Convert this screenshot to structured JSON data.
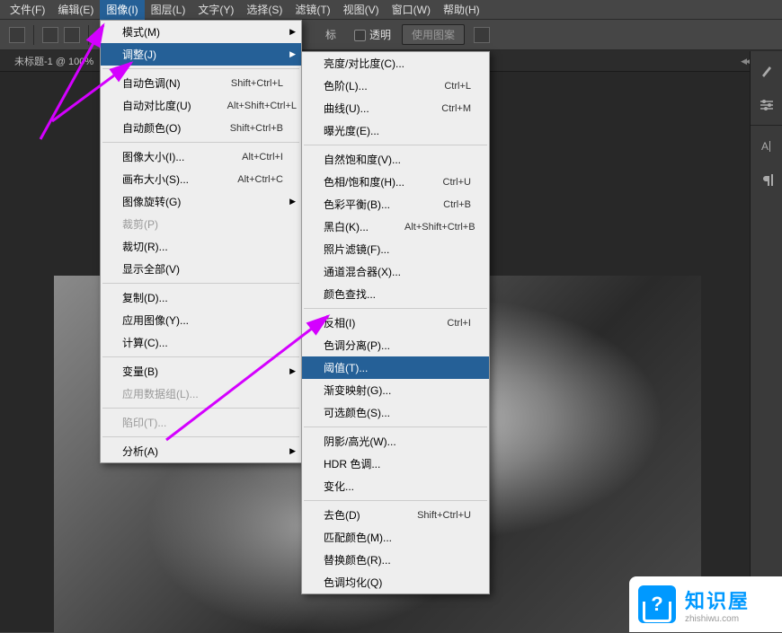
{
  "menubar": {
    "items": [
      {
        "label": "文件(F)"
      },
      {
        "label": "编辑(E)"
      },
      {
        "label": "图像(I)",
        "active": true
      },
      {
        "label": "图层(L)"
      },
      {
        "label": "文字(Y)"
      },
      {
        "label": "选择(S)"
      },
      {
        "label": "滤镜(T)"
      },
      {
        "label": "视图(V)"
      },
      {
        "label": "窗口(W)"
      },
      {
        "label": "帮助(H)"
      }
    ]
  },
  "toolbar": {
    "target_label": "标",
    "transparent_label": "透明",
    "pattern_btn": "使用图案"
  },
  "doc_tab": "未标题-1 @ 100%",
  "image_menu": {
    "groups": [
      [
        {
          "label": "模式(M)",
          "submenu": true
        },
        {
          "label": "调整(J)",
          "submenu": true,
          "highlighted": true
        }
      ],
      [
        {
          "label": "自动色调(N)",
          "shortcut": "Shift+Ctrl+L"
        },
        {
          "label": "自动对比度(U)",
          "shortcut": "Alt+Shift+Ctrl+L"
        },
        {
          "label": "自动颜色(O)",
          "shortcut": "Shift+Ctrl+B"
        }
      ],
      [
        {
          "label": "图像大小(I)...",
          "shortcut": "Alt+Ctrl+I"
        },
        {
          "label": "画布大小(S)...",
          "shortcut": "Alt+Ctrl+C"
        },
        {
          "label": "图像旋转(G)",
          "submenu": true
        },
        {
          "label": "裁剪(P)",
          "disabled": true
        },
        {
          "label": "裁切(R)..."
        },
        {
          "label": "显示全部(V)"
        }
      ],
      [
        {
          "label": "复制(D)..."
        },
        {
          "label": "应用图像(Y)..."
        },
        {
          "label": "计算(C)..."
        }
      ],
      [
        {
          "label": "变量(B)",
          "submenu": true
        },
        {
          "label": "应用数据组(L)...",
          "disabled": true
        }
      ],
      [
        {
          "label": "陷印(T)...",
          "disabled": true
        }
      ],
      [
        {
          "label": "分析(A)",
          "submenu": true
        }
      ]
    ]
  },
  "adjust_menu": {
    "groups": [
      [
        {
          "label": "亮度/对比度(C)..."
        },
        {
          "label": "色阶(L)...",
          "shortcut": "Ctrl+L"
        },
        {
          "label": "曲线(U)...",
          "shortcut": "Ctrl+M"
        },
        {
          "label": "曝光度(E)..."
        }
      ],
      [
        {
          "label": "自然饱和度(V)..."
        },
        {
          "label": "色相/饱和度(H)...",
          "shortcut": "Ctrl+U"
        },
        {
          "label": "色彩平衡(B)...",
          "shortcut": "Ctrl+B"
        },
        {
          "label": "黑白(K)...",
          "shortcut": "Alt+Shift+Ctrl+B"
        },
        {
          "label": "照片滤镜(F)..."
        },
        {
          "label": "通道混合器(X)..."
        },
        {
          "label": "颜色查找..."
        }
      ],
      [
        {
          "label": "反相(I)",
          "shortcut": "Ctrl+I"
        },
        {
          "label": "色调分离(P)..."
        },
        {
          "label": "阈值(T)...",
          "highlighted": true
        },
        {
          "label": "渐变映射(G)..."
        },
        {
          "label": "可选颜色(S)..."
        }
      ],
      [
        {
          "label": "阴影/高光(W)..."
        },
        {
          "label": "HDR 色调..."
        },
        {
          "label": "变化..."
        }
      ],
      [
        {
          "label": "去色(D)",
          "shortcut": "Shift+Ctrl+U"
        },
        {
          "label": "匹配颜色(M)..."
        },
        {
          "label": "替换颜色(R)..."
        },
        {
          "label": "色调均化(Q)"
        }
      ]
    ]
  },
  "watermark": {
    "title": "知识屋",
    "sub": "zhishiwu.com"
  }
}
